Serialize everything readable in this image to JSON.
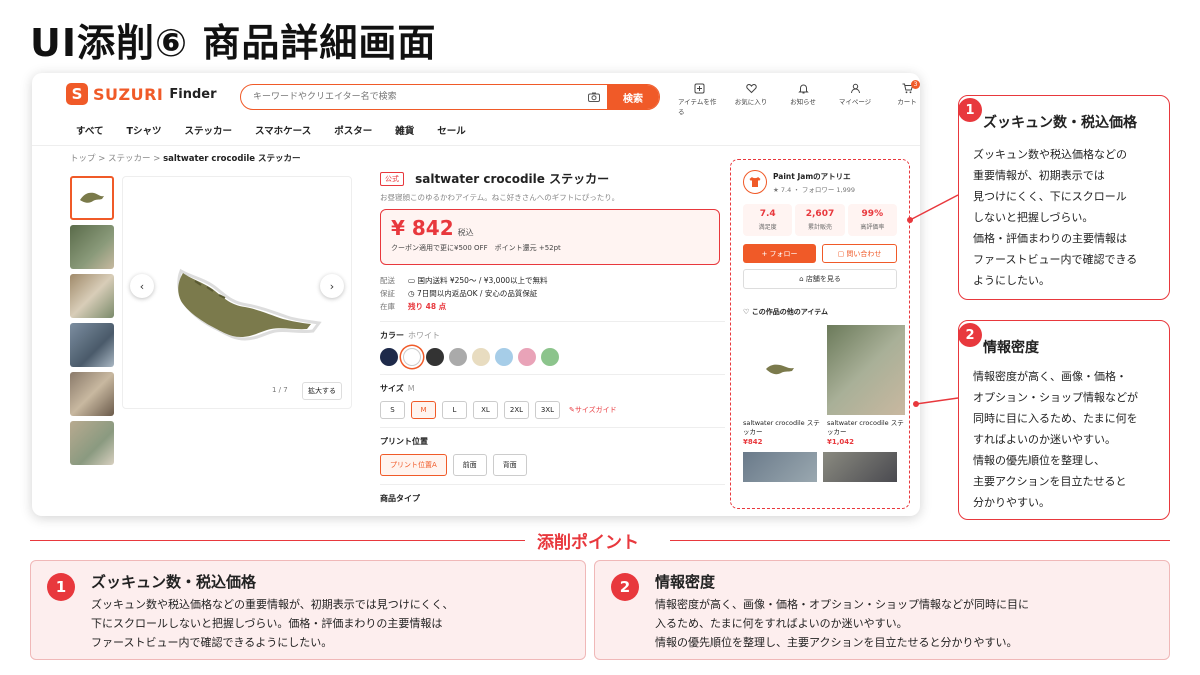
{
  "slide_title": "UI添削⑥ 商品詳細画面",
  "header": {
    "logo_mark": "S",
    "logo_text": "SUZURI",
    "logo_sub": "Finder",
    "search_placeholder": "キーワードやクリエイター名で検索",
    "search_button": "検索",
    "icons": [
      {
        "label": "アイテムを作る",
        "icon": "create-icon"
      },
      {
        "label": "お気に入り",
        "icon": "heart-icon"
      },
      {
        "label": "お知らせ",
        "icon": "bell-icon"
      },
      {
        "label": "マイページ",
        "icon": "user-icon"
      },
      {
        "label": "カート",
        "icon": "cart-icon"
      }
    ],
    "cart_count": "3"
  },
  "nav": [
    "すべて",
    "Tシャツ",
    "ステッカー",
    "スマホケース",
    "ポスター",
    "雑貨",
    "セール"
  ],
  "breadcrumb": {
    "items": [
      "トップ",
      ">",
      "ステッカー",
      ">"
    ],
    "current": "saltwater crocodile ステッカー"
  },
  "gallery": {
    "counter": "1 / 7",
    "zoom_label": "拡大する"
  },
  "product": {
    "badge": "公式",
    "title": "saltwater crocodile ステッカー",
    "desc": "お昼寝顔このゆるかわアイテム。ねこ好きさんへのギフトにぴったり。",
    "price": "¥ 842",
    "tax": "税込",
    "coupon": "クーポン適用で更に¥500 OFF　ポイント還元 +52pt",
    "meta": [
      {
        "k": "配送",
        "v": "国内送料 ¥250〜 / ¥3,000以上で無料"
      },
      {
        "k": "保証",
        "v": "7日間以内返品OK / 安心の品質保証"
      },
      {
        "k": "在庫",
        "v": "残り 48 点"
      }
    ],
    "color_label": "カラー",
    "color_value": "ホワイト",
    "colors": [
      "#1e2a4a",
      "#ffffff",
      "#333333",
      "#aaaaaa",
      "#e8dcc0",
      "#a6cde8",
      "#e9a3b8",
      "#8cc48c"
    ],
    "size_label": "サイズ",
    "size_value": "M",
    "sizes": [
      "S",
      "M",
      "L",
      "XL",
      "2XL",
      "3XL"
    ],
    "size_guide": "サイズガイド",
    "print_label": "プリント位置",
    "prints": [
      "プリント位置A",
      "前面",
      "背面"
    ],
    "type_label": "商品タイプ"
  },
  "shop": {
    "name": "Paint Jamのアトリエ",
    "sub": "★ 7.4 ・ フォロワー 1,999",
    "stats": [
      {
        "v": "7.4",
        "l": "満足度"
      },
      {
        "v": "2,607",
        "l": "累計販売"
      },
      {
        "v": "99%",
        "l": "高評価率"
      }
    ],
    "follow": "+ フォロー",
    "contact": "問い合わせ",
    "store": "店舗を見る",
    "other_title": "この作品の他のアイテム",
    "items": [
      {
        "name": "saltwater crocodile ステッカー",
        "price": "¥842"
      },
      {
        "name": "saltwater crocodile ステッカー",
        "price": "¥1,042"
      }
    ]
  },
  "callouts": [
    {
      "num": "1",
      "title": "ズッキュン数・税込価格",
      "lines": [
        "ズッキュン数や税込価格などの",
        "重要情報が、初期表示では",
        "見つけにくく、下にスクロール",
        "しないと把握しづらい。",
        "価格・評価まわりの主要情報は",
        "ファーストビュー内で確認できる",
        "ようにしたい。"
      ]
    },
    {
      "num": "2",
      "title": "情報密度",
      "lines": [
        "情報密度が高く、画像・価格・",
        "オプション・ショップ情報などが",
        "同時に目に入るため、たまに何を",
        "すればよいのか迷いやすい。",
        "情報の優先順位を整理し、",
        "主要アクションを目立たせると",
        "分かりやすい。"
      ]
    }
  ],
  "points_title": "添削ポイント",
  "points": [
    {
      "num": "1",
      "title": "ズッキュン数・税込価格",
      "lines": [
        "ズッキュン数や税込価格などの重要情報が、初期表示では見つけにくく、",
        "下にスクロールしないと把握しづらい。価格・評価まわりの主要情報は",
        "ファーストビュー内で確認できるようにしたい。"
      ]
    },
    {
      "num": "2",
      "title": "情報密度",
      "lines": [
        "情報密度が高く、画像・価格・オプション・ショップ情報などが同時に目に",
        "入るため、たまに何をすればよいのか迷いやすい。",
        "情報の優先順位を整理し、主要アクションを目立たせると分かりやすい。"
      ]
    }
  ],
  "colors": {
    "brand": "#f05a28",
    "accent": "#e8383d"
  }
}
